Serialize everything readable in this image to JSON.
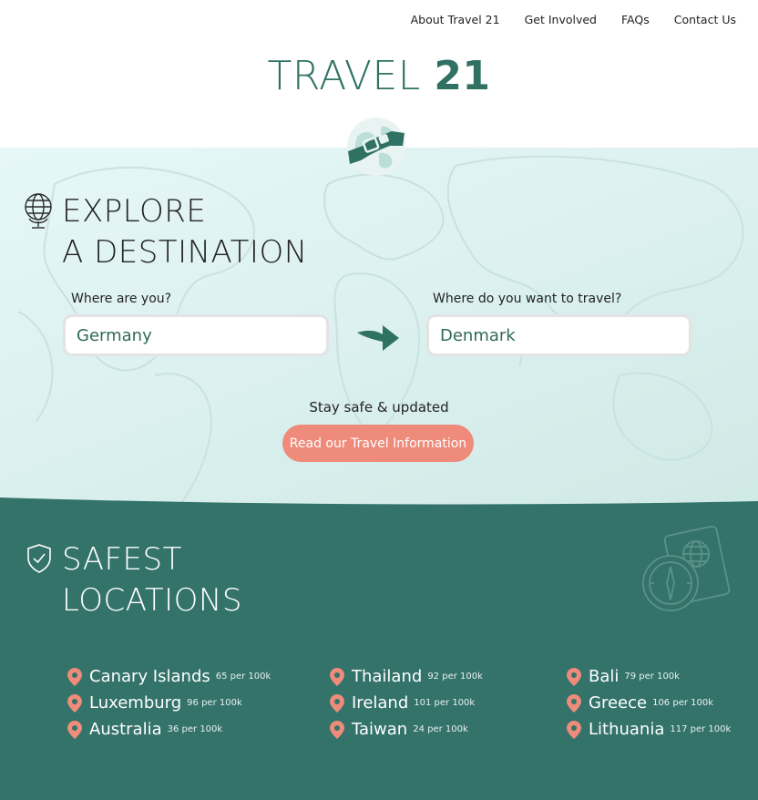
{
  "nav": {
    "items": [
      "About Travel 21",
      "Get Involved",
      "FAQs",
      "Contact Us"
    ]
  },
  "brand": {
    "light": "TRAVEL",
    "bold": "21"
  },
  "explore": {
    "title_line1": "EXPLORE",
    "title_line2": "A DESTINATION",
    "from_label": "Where are you?",
    "from_value": "Germany",
    "to_label": "Where do you want to travel?",
    "to_value": "Denmark",
    "stay_text": "Stay safe & updated",
    "cta_label": "Read our Travel Information"
  },
  "safest": {
    "title_line1": "SAFEST",
    "title_line2": "LOCATIONS",
    "columns": [
      [
        {
          "name": "Canary Islands",
          "rate": "65 per 100k"
        },
        {
          "name": "Luxemburg",
          "rate": "96 per 100k"
        },
        {
          "name": "Australia",
          "rate": "36 per 100k"
        }
      ],
      [
        {
          "name": "Thailand",
          "rate": "92 per 100k"
        },
        {
          "name": "Ireland",
          "rate": "101 per 100k"
        },
        {
          "name": "Taiwan",
          "rate": "24 per 100k"
        }
      ],
      [
        {
          "name": "Bali",
          "rate": "79 per 100k"
        },
        {
          "name": "Greece",
          "rate": "106 per 100k"
        },
        {
          "name": "Lithuania",
          "rate": "117 per 100k"
        }
      ]
    ]
  },
  "colors": {
    "brand_green": "#2f7263",
    "section_green": "#33736a",
    "accent_coral": "#ee8b7a",
    "hero_bg": "#dcf1f0"
  },
  "icons": {
    "explore": "globe-icon",
    "badge": "seatbelt-globe-icon",
    "arrow": "arrow-right-icon",
    "safe": "shield-check-icon",
    "passport": "passport-compass-icon",
    "pin": "map-pin-icon"
  }
}
